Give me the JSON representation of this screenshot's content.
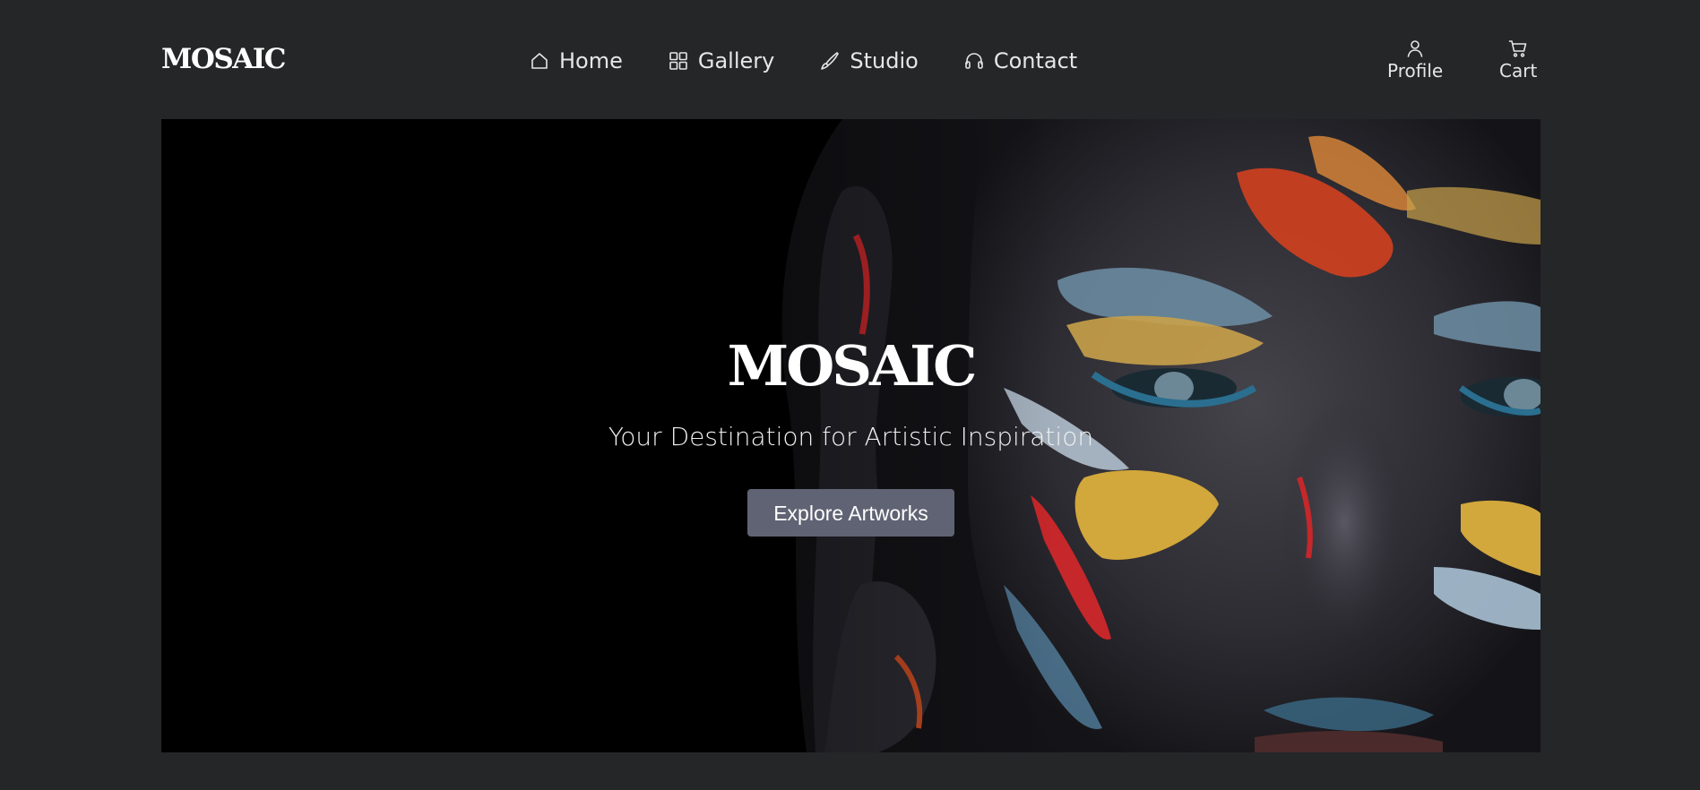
{
  "brand": {
    "logo_text": "MOSAIC"
  },
  "nav": {
    "items": [
      {
        "label": "Home",
        "icon": "home-icon"
      },
      {
        "label": "Gallery",
        "icon": "grid-icon"
      },
      {
        "label": "Studio",
        "icon": "brush-icon"
      },
      {
        "label": "Contact",
        "icon": "headset-icon"
      }
    ]
  },
  "utility": {
    "profile_label": "Profile",
    "profile_icon": "user-icon",
    "cart_label": "Cart",
    "cart_icon": "cart-icon"
  },
  "hero": {
    "title": "MOSAIC",
    "subtitle": "Your Destination for Artistic Inspiration",
    "cta_label": "Explore Artworks",
    "image": "painted-face-portrait",
    "colors": {
      "background": "#252628",
      "hero_bg": "#000000",
      "button_bg": "#5f6373",
      "text": "#ffffff"
    }
  }
}
